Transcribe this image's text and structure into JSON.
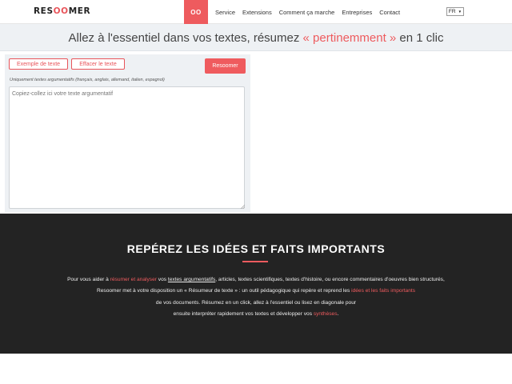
{
  "header": {
    "logo": {
      "left": "RES",
      "accent": "OO",
      "right": "MER"
    },
    "nav": {
      "home": "OO",
      "items": [
        "Service",
        "Extensions",
        "Comment ça marche",
        "Entreprises",
        "Contact"
      ]
    },
    "language": {
      "selected": "FR"
    }
  },
  "headline": {
    "before": "Allez à l'essentiel dans vos textes, résumez ",
    "accent": "« pertinemment »",
    "after": " en 1 clic"
  },
  "tool": {
    "example_button": "Exemple de texte",
    "clear_button": "Effacer le texte",
    "submit_button": "Resoomer",
    "note": "Uniquement textes argumentatifs (français, anglais, allemand, italien, espagnol)",
    "textarea_placeholder": "Copiez-collez ici votre texte argumentatif"
  },
  "section": {
    "title": "REPÉREZ LES IDÉES ET FAITS IMPORTANTS",
    "line1": {
      "a": "Pour vous aider à ",
      "red1": "résumer et analyser",
      "b": " vos ",
      "ul": "textes argumentatifs",
      "c": ", articles, textes scientifiques, textes d'histoire, ou encore commentaires d'oeuvres bien structurés,"
    },
    "line2": {
      "a": "Resoomer met à votre disposition un « Résumeur de texte » : un outil pédagogique qui repère et reprend les ",
      "red": "idées et les faits importants"
    },
    "line3": "de vos documents. Résumez en un click, allez à l'essentiel ou lisez en diagonale pour",
    "line4": {
      "a": "ensuite interpréter rapidement vos textes et développer vos ",
      "red": "synthèses",
      "b": "."
    }
  },
  "colors": {
    "accent": "#ee5b5e",
    "dark_bg": "#232323",
    "panel_bg": "#eef1f4"
  }
}
